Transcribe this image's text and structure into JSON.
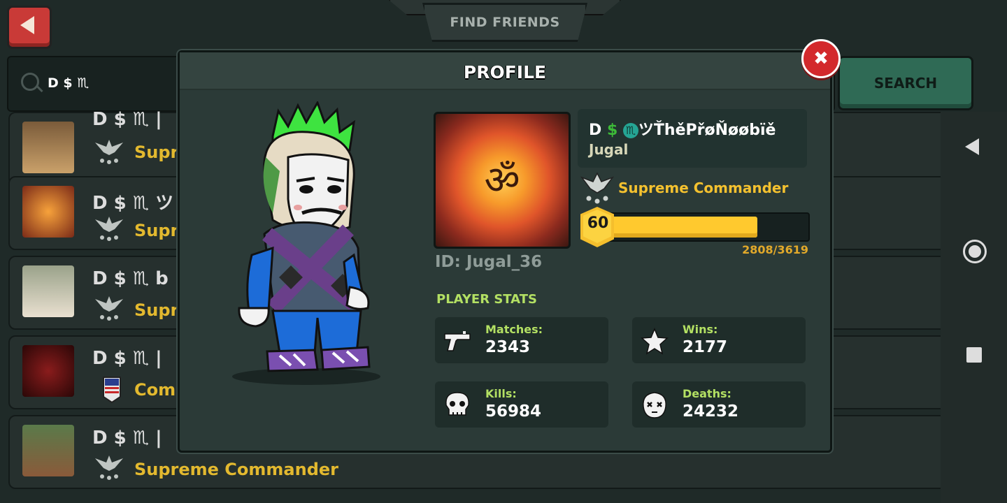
{
  "top_bar": {
    "title": "FIND FRIENDS"
  },
  "search": {
    "value": "D $ ♏",
    "button_label": "SEARCH"
  },
  "list": [
    {
      "name": "D $ ♏ |",
      "rank": "Supre"
    },
    {
      "name": "D $ ♏ ツ",
      "rank": "Supre"
    },
    {
      "name": "D $ ♏ b",
      "rank": "Supre"
    },
    {
      "name": "D $ ♏ |",
      "rank": "Comm"
    },
    {
      "name": "D $ ♏ |",
      "rank": "Supreme Commander"
    }
  ],
  "modal": {
    "title": "PROFILE",
    "close_icon": "close-icon",
    "player_id": "ID: Jugal_36",
    "name_prefix_d": "D",
    "name_prefix_dollar": "$",
    "name_prefix_m": "♏",
    "name_suffix": "ツŤhěPřøŇøøbïě",
    "real_name": "Jugal",
    "rank": "Supreme Commander",
    "level": "60",
    "xp_text": "2808/3619",
    "xp_current": 2808,
    "xp_max": 3619,
    "stats_title": "PLAYER STATS",
    "stats": [
      {
        "label": "Matches:",
        "value": "2343",
        "icon": "pistol-icon"
      },
      {
        "label": "Wins:",
        "value": "2177",
        "icon": "star-icon"
      },
      {
        "label": "Kills:",
        "value": "56984",
        "icon": "skull-icon"
      },
      {
        "label": "Deaths:",
        "value": "24232",
        "icon": "dead-face-icon"
      }
    ]
  },
  "colors": {
    "accent_yellow": "#f4c12f",
    "stat_label_green": "#b3e063",
    "close_red": "#d3292c"
  }
}
